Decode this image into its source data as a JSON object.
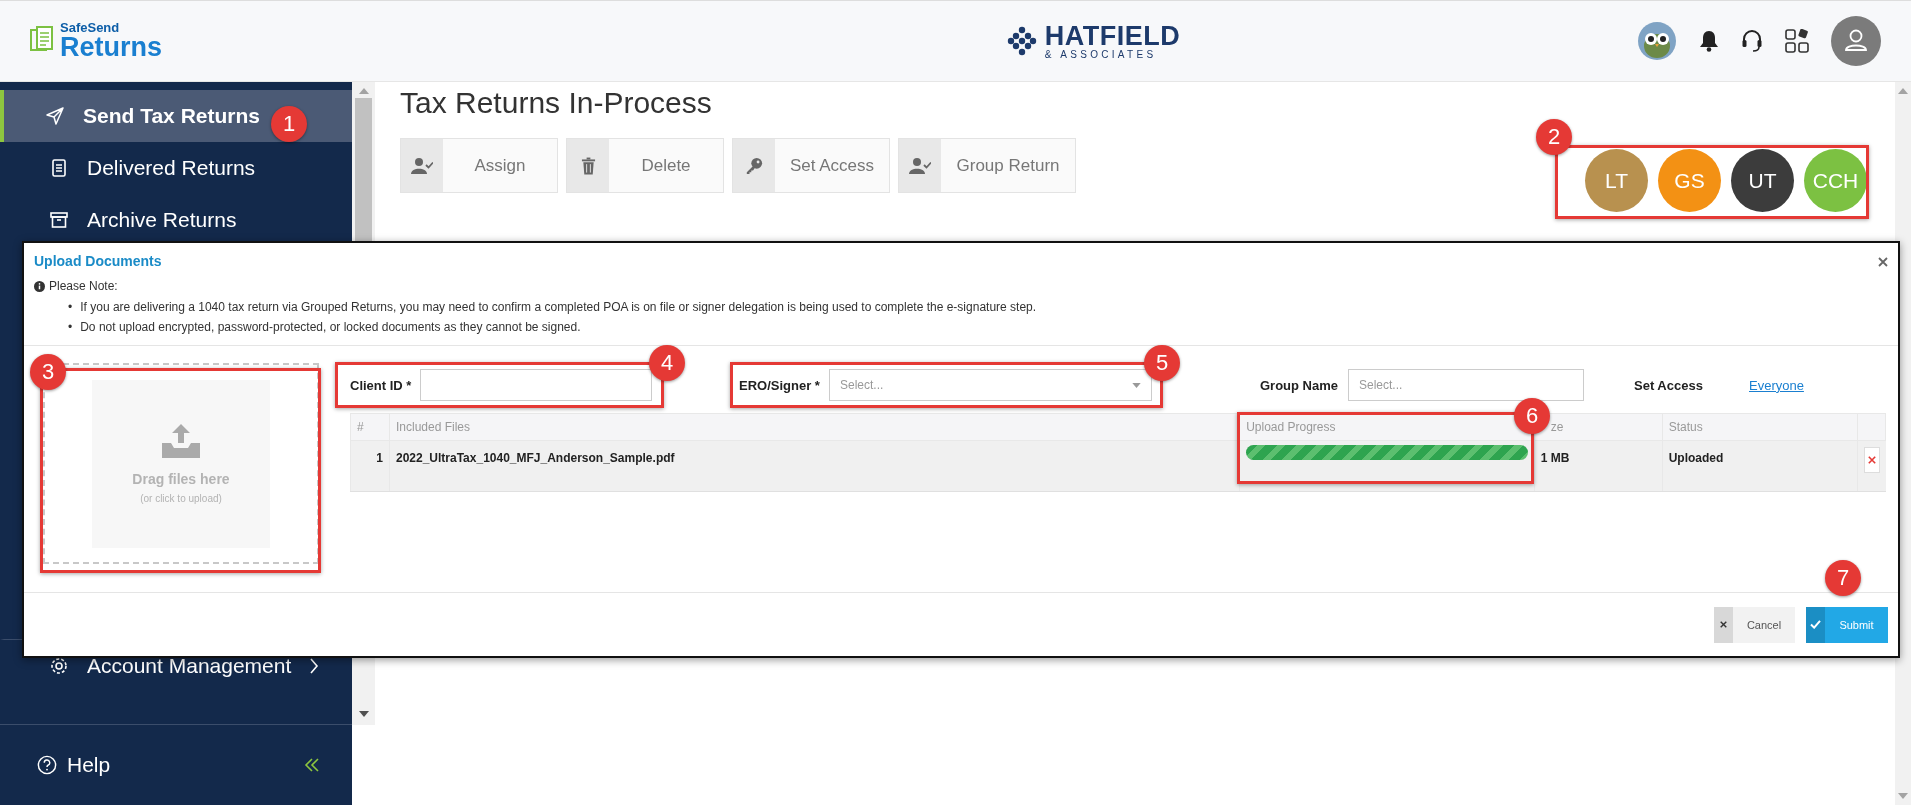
{
  "header": {
    "logo_top": "SafeSend",
    "logo_bottom": "Returns",
    "firm_name": "HATFIELD",
    "firm_sub": "& ASSOCIATES"
  },
  "sidebar": {
    "items": [
      {
        "label": "Send Tax Returns",
        "kind": "send",
        "selected": true
      },
      {
        "label": "Delivered Returns",
        "kind": "document",
        "selected": false
      },
      {
        "label": "Archive Returns",
        "kind": "archive",
        "selected": false
      }
    ],
    "account": {
      "label": "Account Management",
      "kind": "gear"
    },
    "help": "Help"
  },
  "main": {
    "title": "Tax Returns In-Process",
    "toolbar": [
      {
        "label": "Assign",
        "kind": "assign"
      },
      {
        "label": "Delete",
        "kind": "delete"
      },
      {
        "label": "Set Access",
        "kind": "key"
      },
      {
        "label": "Group Return",
        "kind": "assign"
      }
    ],
    "avatars": [
      {
        "initials": "LT",
        "color": "#b8914f"
      },
      {
        "initials": "GS",
        "color": "#f39114"
      },
      {
        "initials": "UT",
        "color": "#3c3c3c"
      },
      {
        "initials": "CCH",
        "color": "#7cc142"
      }
    ]
  },
  "modal": {
    "title": "Upload Documents",
    "note_heading": "Please Note:",
    "notes": [
      {
        "bullet": "•",
        "text": "If you are delivering a 1040 tax return via Grouped Returns, you may need to confirm a completed POA is on file or signer delegation is being used to complete the e-signature step."
      },
      {
        "bullet": "•",
        "text": "Do not upload encrypted, password-protected, or locked documents as they cannot be signed."
      }
    ],
    "drop_title": "Drag files here",
    "drop_hint": "(or click to upload)",
    "client_id": {
      "label": "Client ID *"
    },
    "ero_signer": {
      "label": "ERO/Signer *",
      "placeholder": "Select..."
    },
    "group_name": {
      "label": "Group Name",
      "placeholder": "Select..."
    },
    "set_access": {
      "label": "Set Access",
      "link": "Everyone"
    },
    "columns": [
      "#",
      "Included Files",
      "Upload Progress",
      "ze",
      "Status"
    ],
    "rows": [
      {
        "number": "1",
        "file": "2022_UltraTax_1040_MFJ_Anderson_Sample.pdf",
        "level": 1,
        "size": "1 MB",
        "status": "Uploaded"
      }
    ],
    "cancel": "Cancel",
    "submit": "Submit"
  },
  "annotations": [
    "1",
    "2",
    "3",
    "4",
    "5",
    "6",
    "7"
  ]
}
